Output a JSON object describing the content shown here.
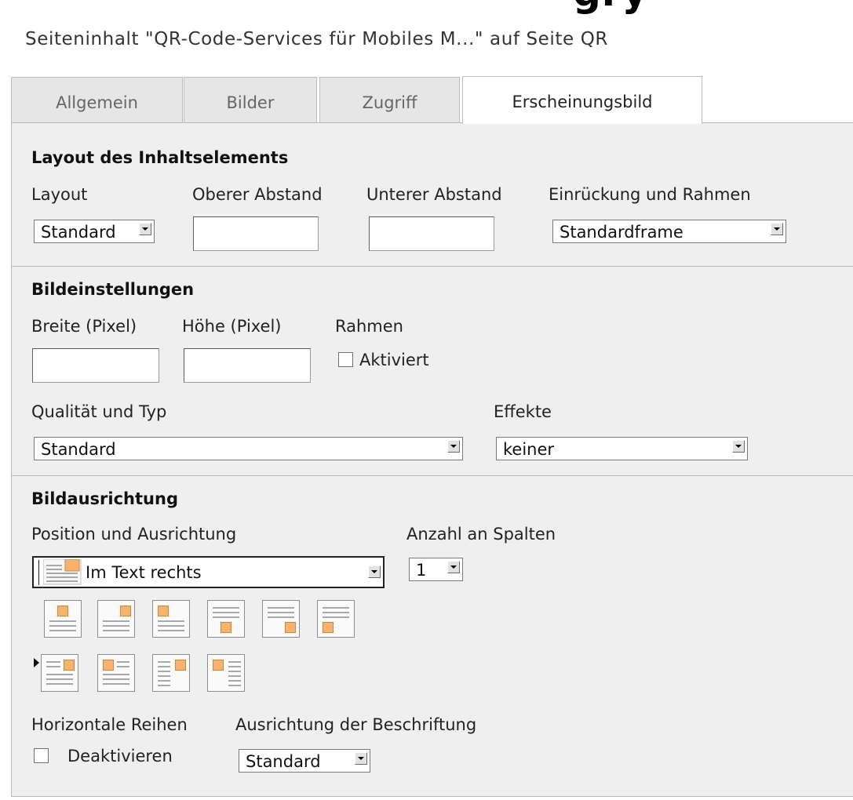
{
  "header": {
    "cut_title": "gry",
    "page_heading": "Seiteninhalt \"QR-Code-Services für Mobiles M...\" auf Seite QR"
  },
  "tabs": [
    {
      "label": "Allgemein",
      "active": false
    },
    {
      "label": "Bilder",
      "active": false
    },
    {
      "label": "Zugriff",
      "active": false
    },
    {
      "label": "Erscheinungsbild",
      "active": true
    }
  ],
  "layout_section": {
    "title": "Layout des Inhaltselements",
    "layout_label": "Layout",
    "layout_value": "Standard",
    "top_spacing_label": "Oberer Abstand",
    "top_spacing_value": "",
    "bottom_spacing_label": "Unterer Abstand",
    "bottom_spacing_value": "",
    "frame_label": "Einrückung und Rahmen",
    "frame_value": "Standardframe"
  },
  "image_settings": {
    "title": "Bildeinstellungen",
    "width_label": "Breite (Pixel)",
    "width_value": "",
    "height_label": "Höhe (Pixel)",
    "height_value": "",
    "border_label": "Rahmen",
    "border_checkbox_label": "Aktiviert",
    "border_checked": false,
    "quality_label": "Qualität und Typ",
    "quality_value": "Standard",
    "effects_label": "Effekte",
    "effects_value": "keiner"
  },
  "image_alignment": {
    "title": "Bildausrichtung",
    "position_label": "Position und Ausrichtung",
    "position_value": "Im Text rechts",
    "columns_label": "Anzahl an Spalten",
    "columns_value": "1",
    "horizontal_rows_label": "Horizontale Reihen",
    "horizontal_rows_checkbox_label": "Deaktivieren",
    "horizontal_rows_checked": false,
    "caption_align_label": "Ausrichtung der Beschriftung",
    "caption_align_value": "Standard"
  },
  "colors": {
    "panel_bg": "#efefef",
    "image_orange": "#f7b36b",
    "border": "#b9b9b9"
  }
}
